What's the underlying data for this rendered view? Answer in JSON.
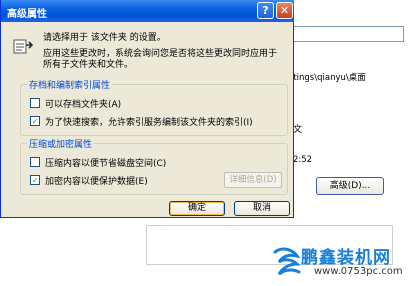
{
  "background": {
    "path_text": "ttings\\qianyu\\桌面",
    "truncated_text": "文",
    "time_text": "2:52",
    "advanced_button": "高级(D)..."
  },
  "dialog": {
    "title": "高级属性",
    "help_glyph": "?",
    "close_glyph": "✕",
    "header": {
      "line1": "请选择用于 该文件夹 的设置。",
      "line2": "应用这些更改时，系统会询问您是否将这些更改同时应用于",
      "line3": "所有子文件夹和文件。"
    },
    "archive_group": {
      "label": "存档和编制索引属性",
      "archive_checkbox": {
        "label": "可以存档文件夹(A)",
        "checked": false
      },
      "index_checkbox": {
        "label": "为了快速搜索，允许索引服务编制该文件夹的索引(I)",
        "checked": true
      }
    },
    "compress_group": {
      "label": "压缩或加密属性",
      "compress_checkbox": {
        "label": "压缩内容以便节省磁盘空间(C)",
        "checked": false
      },
      "encrypt_checkbox": {
        "label": "加密内容以便保护数据(E)",
        "checked": true
      },
      "details_button": "详细信息(D)"
    },
    "ok_button": "确定",
    "cancel_button": "取消"
  },
  "watermark": {
    "brand": "鹏鑫装机网",
    "url": "www.0753pc.com"
  },
  "colors": {
    "title_bar": "#0a5fe0",
    "dialog_bg": "#ece9d8",
    "group_label": "#0046d5",
    "watermark": "#1a7fd8"
  }
}
